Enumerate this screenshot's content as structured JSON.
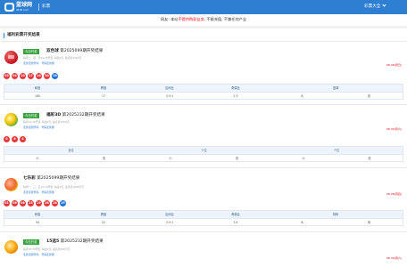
{
  "header": {
    "logo_main": "蓝球网",
    "logo_sub": "lt138.com",
    "channel": "彩票",
    "menu_label": "彩票大全"
  },
  "notice": {
    "prefix": "网友: 本站",
    "warning": "不提供购彩业务",
    "suffix": ", 不能充值, 不兼任何产业"
  },
  "section_title": "福利彩票开奖结果",
  "games": [
    {
      "icon": "ssq-icon",
      "tag": "今日开奖",
      "name": "双色球",
      "issue": "第2025099期开奖结果",
      "meta": "每周二、四、日21:15开奖, 每注2元, 最高奖1000万",
      "links": [
        "走势定胆号码",
        "号码走势图"
      ],
      "date": "08-26(周日)",
      "balls": [
        {
          "n": "03",
          "color": "red"
        },
        {
          "n": "04",
          "color": "red"
        },
        {
          "n": "10",
          "color": "red"
        },
        {
          "n": "17",
          "color": "red"
        },
        {
          "n": "24",
          "color": "red"
        },
        {
          "n": "30",
          "color": "red"
        },
        {
          "n": "16",
          "color": "blue"
        }
      ],
      "stats": {
        "headers": [
          "和值",
          "跨度",
          "区间比",
          "奇偶比",
          "蓝球"
        ],
        "values": [
          "180",
          "17",
          "3:3:1",
          "2:3",
          "大",
          "双"
        ]
      }
    },
    {
      "icon": "3d-icon",
      "tag": "今日开奖",
      "name": "福彩3D",
      "issue": "第2025232期开奖结果",
      "meta": "每天21:15开奖, 每注2元, 最高奖1040元",
      "links": [
        "走势定胆号码",
        "号码走势图"
      ],
      "date": "08-30(周六)",
      "balls": [
        {
          "n": "0",
          "color": "red"
        },
        {
          "n": "8",
          "color": "red"
        },
        {
          "n": "4",
          "color": "red"
        }
      ],
      "stats": {
        "headers": [
          "百位",
          "十位",
          "个位"
        ],
        "values": [
          "小",
          "双",
          "小",
          "双",
          "小",
          "双"
        ]
      }
    },
    {
      "icon": "qlc-icon",
      "tag": "",
      "name": "七乐彩",
      "issue": "第2025099期开奖结果",
      "meta": "每周一、三、五21:15开奖, 每注2元, 最高奖1000万元",
      "links": [
        "走势定胆号码",
        "号码走势图"
      ],
      "date": "08-28(周四)",
      "balls": [
        {
          "n": "01",
          "color": "red"
        },
        {
          "n": "06",
          "color": "red"
        },
        {
          "n": "08",
          "color": "red"
        },
        {
          "n": "15",
          "color": "red"
        },
        {
          "n": "19",
          "color": "red"
        },
        {
          "n": "26",
          "color": "red"
        },
        {
          "n": "28",
          "color": "red"
        },
        {
          "n": "29",
          "color": "blue"
        }
      ],
      "stats": {
        "headers": [
          "和值",
          "跨度",
          "区间比",
          "奇偶比",
          "特码"
        ],
        "values": [
          "94",
          "22",
          "3:3:1",
          "3:4",
          "大",
          "单"
        ]
      }
    },
    {
      "icon": "15x5-icon",
      "tag": "今日开奖",
      "name": "15选5",
      "issue": "第2025232期开奖结果",
      "meta": "每天20:30开奖, 每注2元, 最高奖300万元",
      "links": [
        "走势定胆号码",
        "号码走势图"
      ],
      "date": "08-30(周六)"
    }
  ],
  "colors": {
    "brand": "#2e7fd1",
    "ball_red": "#e4393c",
    "ball_blue": "#1f74d6",
    "tag_green": "#36a13c",
    "date_red": "#e60012"
  }
}
